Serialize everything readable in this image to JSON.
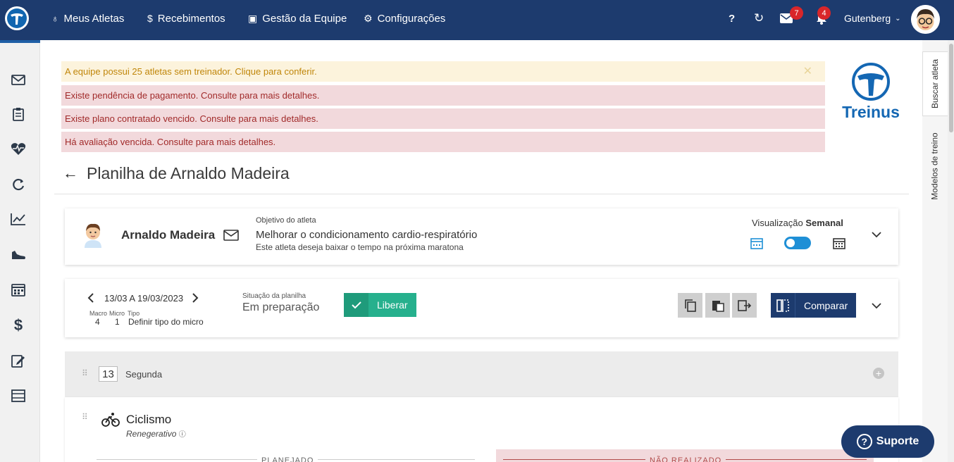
{
  "topbar": {
    "nav": [
      {
        "icon": "medal-icon",
        "glyph": "🏅",
        "label": "Meus Atletas"
      },
      {
        "icon": "dollar-icon",
        "glyph": "$",
        "label": "Recebimentos"
      },
      {
        "icon": "id-card-icon",
        "glyph": "▣",
        "label": "Gestão da Equipe"
      },
      {
        "icon": "gears-icon",
        "glyph": "⚙",
        "label": "Configurações"
      }
    ],
    "help": "?",
    "sync_icon": "↻",
    "messages_count": "7",
    "notifications_count": "4",
    "user_name": "Gutenberg"
  },
  "alerts": [
    "A equipe possui 25 atletas sem treinador. Clique para conferir.",
    "Existe pendência de pagamento. Consulte para mais detalhes.",
    "Existe plano contratado vencido. Consulte para mais detalhes.",
    "Há avaliação vencida. Consulte para mais detalhes."
  ],
  "brand": "Treinus",
  "page_title": "Planilha de Arnaldo Madeira",
  "athlete": {
    "name": "Arnaldo Madeira",
    "objective_label": "Objetivo do atleta",
    "objective": "Melhorar o condicionamento cardio-respiratório",
    "objective_note": "Este atleta deseja baixar o tempo na próxima maratona",
    "view_label": "Visualização",
    "view_value": "Semanal"
  },
  "week": {
    "range": "13/03 A 19/03/2023",
    "macro_label": "Macro",
    "micro_label": "Micro",
    "tipo_label": "Tipo",
    "macro_value": "4",
    "micro_value": "1",
    "tipo_value": "Definir tipo do micro",
    "status_label": "Situação da planilha",
    "status_value": "Em preparação",
    "release_button": "Liberar",
    "compare_button": "Comparar"
  },
  "day": {
    "number": "13",
    "name": "Segunda",
    "activity": "Ciclismo",
    "activity_type": "Renegerativo",
    "planned_label": "PLANEJADO",
    "not_done_label": "NÃO REALIZADO"
  },
  "right_tabs": {
    "search": "Buscar atleta",
    "models": "Modelos de treino"
  },
  "support": "Suporte"
}
